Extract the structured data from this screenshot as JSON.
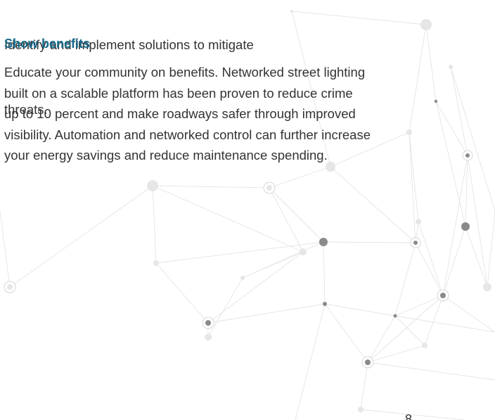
{
  "document": {
    "intro_lines": [
      "Identify and implement solutions to mitigate",
      "threats."
    ],
    "section_heading": "Show benefits",
    "body_lines": [
      "Educate your community on benefits. Networked street lighting",
      "built on a scalable platform has been proven to reduce crime",
      "up to 10 percent and make roadways safer through improved",
      "visibility. Automation and networked control can further increase",
      "your energy savings and reduce maintenance spending."
    ],
    "page_number": "8"
  },
  "colors": {
    "heading": "#16698a",
    "body_text": "#333333",
    "network_line": "#e2e2e2",
    "node_dark": "#8a8a8a",
    "node_light": "#e6e6e6"
  },
  "background_graphic": "network-nodes-decoration"
}
